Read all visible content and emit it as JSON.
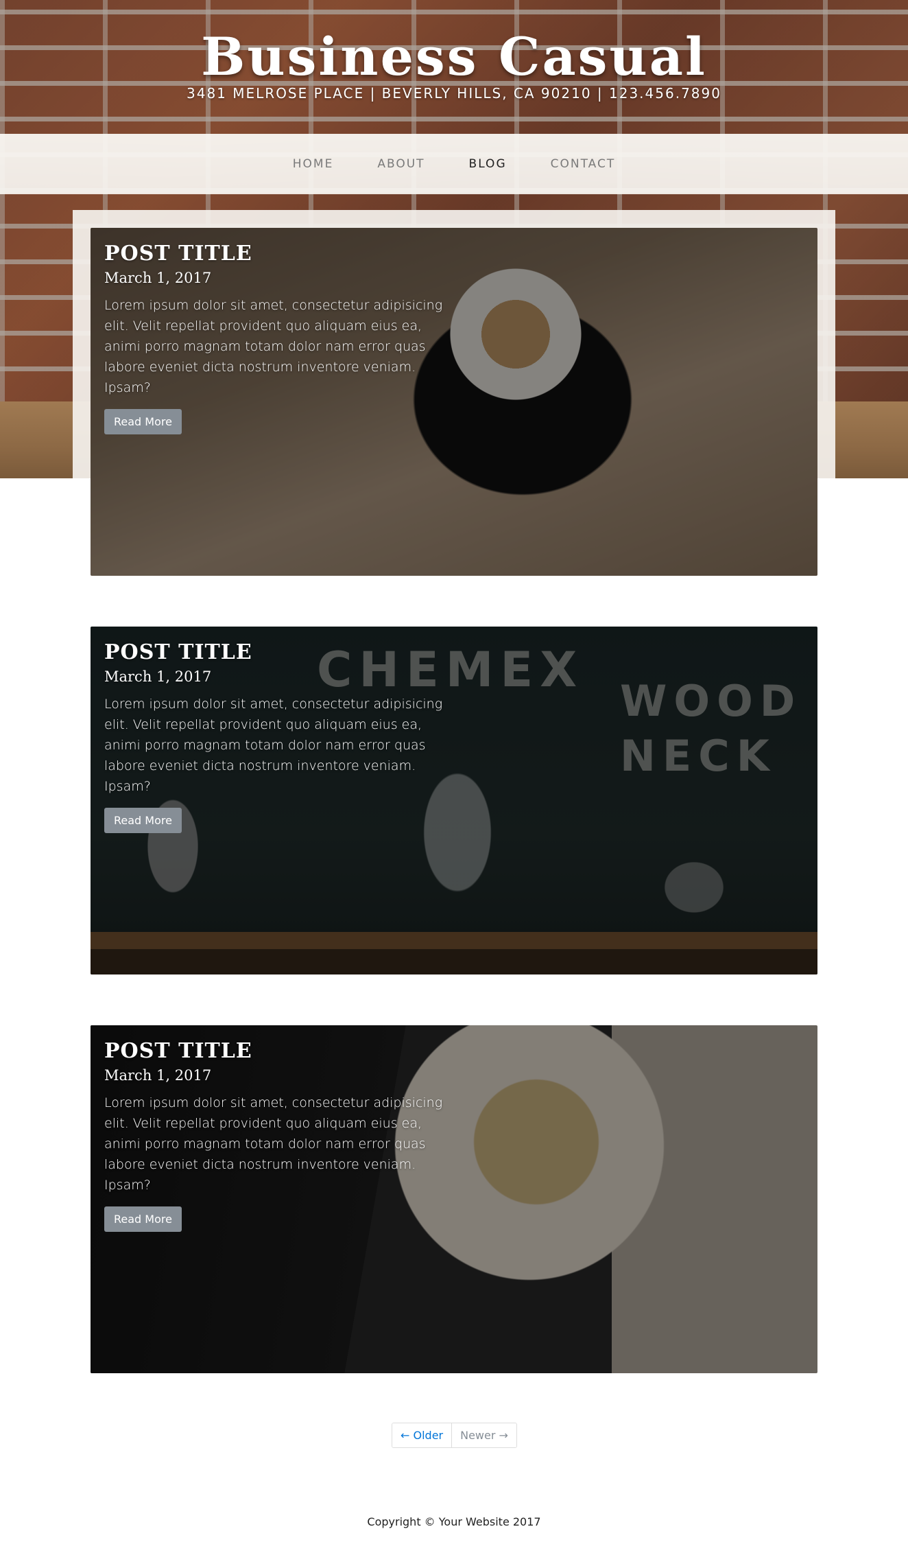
{
  "header": {
    "title": "Business Casual",
    "subtitle": "3481 MELROSE PLACE | BEVERLY HILLS, CA 90210 | 123.456.7890"
  },
  "nav": {
    "items": [
      {
        "label": "HOME"
      },
      {
        "label": "ABOUT"
      },
      {
        "label": "BLOG",
        "active": true
      },
      {
        "label": "CONTACT"
      }
    ]
  },
  "posts": [
    {
      "title": "POST TITLE",
      "date": "March 1, 2017",
      "excerpt": "Lorem ipsum dolor sit amet, consectetur adipisicing elit. Velit repellat provident quo aliquam eius ea, animi porro magnam totam dolor nam error quas labore eveniet dicta nostrum inventore veniam. Ipsam?",
      "button": "Read More"
    },
    {
      "title": "POST TITLE",
      "date": "March 1, 2017",
      "excerpt": "Lorem ipsum dolor sit amet, consectetur adipisicing elit. Velit repellat provident quo aliquam eius ea, animi porro magnam totam dolor nam error quas labore eveniet dicta nostrum inventore veniam. Ipsam?",
      "button": "Read More",
      "image_words": [
        "CHEMEX",
        "WOOD",
        "NECK"
      ]
    },
    {
      "title": "POST TITLE",
      "date": "March 1, 2017",
      "excerpt": "Lorem ipsum dolor sit amet, consectetur adipisicing elit. Velit repellat provident quo aliquam eius ea, animi porro magnam totam dolor nam error quas labore eveniet dicta nostrum inventore veniam. Ipsam?",
      "button": "Read More"
    }
  ],
  "pagination": {
    "older": "← Older",
    "newer": "Newer →"
  },
  "footer": {
    "copyright": "Copyright © Your Website 2017"
  },
  "colors": {
    "button_bg": "#868e96",
    "link_blue": "#0275d8"
  }
}
